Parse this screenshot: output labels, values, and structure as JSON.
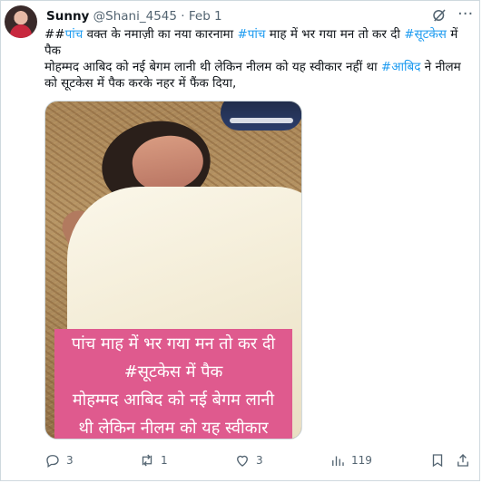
{
  "post": {
    "author_name": "Sunny",
    "author_handle": "@Shani_4545",
    "separator": "·",
    "date": "Feb 1",
    "text_parts": [
      {
        "t": "##",
        "h": false
      },
      {
        "t": "पांच",
        "h": true
      },
      {
        "t": " वक्त के नमाज़ी का नया कारनामा ",
        "h": false
      },
      {
        "t": "#पांच",
        "h": true
      },
      {
        "t": " माह में भर गया मन तो कर दी ",
        "h": false
      },
      {
        "t": "#सूटकेस",
        "h": true
      },
      {
        "t": " में पैक",
        "h": false
      },
      {
        "t": "\n",
        "h": false
      },
      {
        "t": "मोहम्मद आबिद को नई बेगम लानी थी लेकिन नीलम को यह स्वीकार नहीं था ",
        "h": false
      },
      {
        "t": "#आबिद",
        "h": true
      },
      {
        "t": " ने नीलम को सूटकेस में पैक करके नहर में फैंक दिया,",
        "h": false
      }
    ]
  },
  "media": {
    "caption_lines": [
      "पांच माह में भर गया मन तो कर दी",
      "#सूटकेस में पैक",
      "मोहम्मद आबिद को नई बेगम लानी",
      "थी लेकिन नीलम को यह स्वीकार"
    ]
  },
  "actions": {
    "replies": "3",
    "reposts": "1",
    "likes": "3",
    "views": "119"
  },
  "icons": {
    "reply": "reply-icon",
    "repost": "repost-icon",
    "like": "heart-icon",
    "views": "views-icon",
    "bookmark": "bookmark-icon",
    "share": "share-icon",
    "grok": "grok-icon",
    "more": "more-icon"
  },
  "colors": {
    "link": "#1d9bf0",
    "muted": "#536471",
    "caption_bg": "#df5a8e"
  }
}
